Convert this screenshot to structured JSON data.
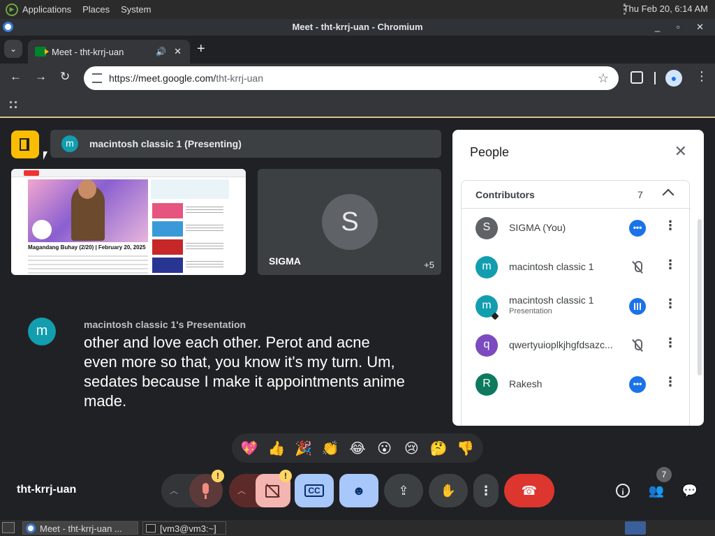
{
  "os": {
    "menu": [
      "Applications",
      "Places",
      "System"
    ],
    "clock": "Thu Feb 20,  6:14 AM"
  },
  "window": {
    "title": "Meet - tht-krrj-uan - Chromium",
    "controls": "_ ▫ ✕"
  },
  "browser": {
    "tab_title": "Meet - tht-krrj-uan",
    "url_host": "https://meet.google.com/",
    "url_path": "tht-krrj-uan",
    "new_tab": "+"
  },
  "meet": {
    "presenting_avatar": "m",
    "presenting_label": "macintosh classic 1 (Presenting)",
    "sigma_tile": {
      "avatar": "S",
      "name": "SIGMA",
      "more": "+5"
    },
    "shared_screen_caption": "Magandang Buhay (2/20) | February 20, 2025",
    "captions": {
      "avatar": "m",
      "speaker": "macintosh classic 1's Presentation",
      "text": "other and love each other. Perot and acne even more so that, you know it's my turn. Um, sedates because I make it appointments anime made."
    },
    "meeting_code": "tht-krrj-uan",
    "reactions": [
      "💖",
      "👍",
      "🎉",
      "👏",
      "😂",
      "😮",
      "😢",
      "🤔",
      "👎"
    ],
    "people_badge": "7",
    "accent": "#1a73e8",
    "leave_color": "#dc362e"
  },
  "people": {
    "title": "People",
    "section": "Contributors",
    "count": "7",
    "rows": [
      {
        "avatar": "S",
        "color": "#5f6368",
        "name": "SIGMA (You)",
        "sub": "",
        "status": "dots"
      },
      {
        "avatar": "m",
        "color": "#129eaf",
        "name": "macintosh classic 1",
        "sub": "",
        "status": "muted"
      },
      {
        "avatar": "m",
        "color": "#129eaf",
        "name": "macintosh classic 1",
        "sub": "Presentation",
        "status": "talk"
      },
      {
        "avatar": "q",
        "color": "#7b4bbf",
        "name": "qwertyuioplkjhgfdsazc...",
        "sub": "",
        "status": "muted"
      },
      {
        "avatar": "R",
        "color": "#0d7a5f",
        "name": "Rakesh",
        "sub": "",
        "status": "dots"
      }
    ]
  },
  "taskbar": {
    "items": [
      "Meet - tht-krrj-uan ...",
      "[vm3@vm3:~]"
    ]
  }
}
